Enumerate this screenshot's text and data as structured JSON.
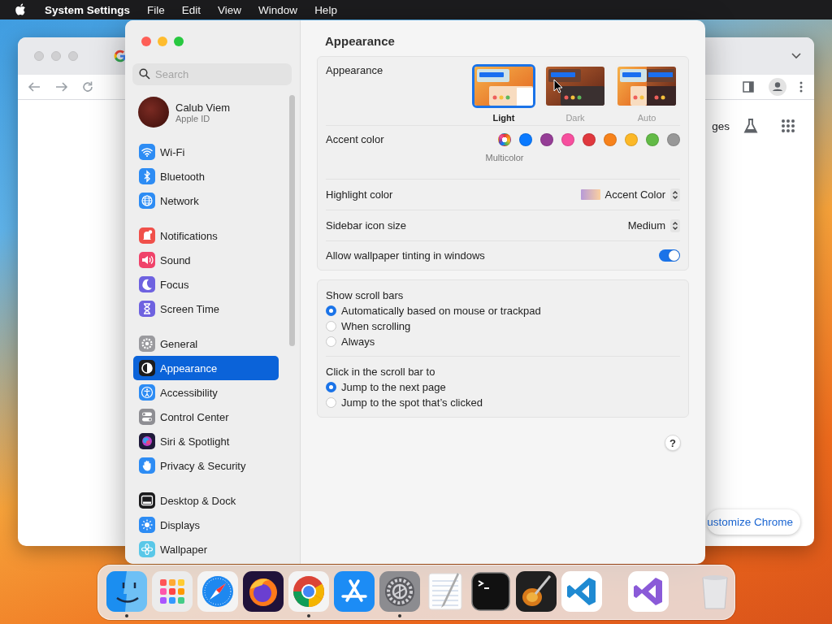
{
  "menu_bar": {
    "app_name": "System Settings",
    "menus": [
      "File",
      "Edit",
      "View",
      "Window",
      "Help"
    ]
  },
  "browser_window": {
    "link_text": "ges",
    "customize_button": "ustomize Chrome"
  },
  "settings_window": {
    "search": {
      "placeholder": "Search"
    },
    "account": {
      "name": "Calub Viem",
      "subtitle": "Apple ID"
    },
    "sidebar": {
      "groups": [
        {
          "items": [
            {
              "label": "Wi-Fi",
              "selected": false
            },
            {
              "label": "Bluetooth",
              "selected": false
            },
            {
              "label": "Network",
              "selected": false
            }
          ]
        },
        {
          "items": [
            {
              "label": "Notifications",
              "selected": false
            },
            {
              "label": "Sound",
              "selected": false
            },
            {
              "label": "Focus",
              "selected": false
            },
            {
              "label": "Screen Time",
              "selected": false
            }
          ]
        },
        {
          "items": [
            {
              "label": "General",
              "selected": false
            },
            {
              "label": "Appearance",
              "selected": true
            },
            {
              "label": "Accessibility",
              "selected": false
            },
            {
              "label": "Control Center",
              "selected": false
            },
            {
              "label": "Siri & Spotlight",
              "selected": false
            },
            {
              "label": "Privacy & Security",
              "selected": false
            }
          ]
        },
        {
          "items": [
            {
              "label": "Desktop & Dock",
              "selected": false
            },
            {
              "label": "Displays",
              "selected": false
            },
            {
              "label": "Wallpaper",
              "selected": false
            }
          ]
        }
      ]
    },
    "title": "Appearance",
    "appearance": {
      "label": "Appearance",
      "options": [
        {
          "kind": "light",
          "label": "Light",
          "selected": true
        },
        {
          "kind": "dark",
          "label": "Dark",
          "selected": false
        },
        {
          "kind": "auto",
          "label": "Auto",
          "selected": false
        }
      ]
    },
    "accent_color": {
      "label": "Accent color",
      "caption": "Multicolor",
      "colors": [
        {
          "kind": "multicolor",
          "selected": true
        },
        {
          "kind": "solid",
          "color": "#0a7aff",
          "selected": false
        },
        {
          "kind": "solid",
          "color": "#953d96",
          "selected": false
        },
        {
          "kind": "solid",
          "color": "#f74f9e",
          "selected": false
        },
        {
          "kind": "solid",
          "color": "#e0383e",
          "selected": false
        },
        {
          "kind": "solid",
          "color": "#f7821b",
          "selected": false
        },
        {
          "kind": "solid",
          "color": "#fcb827",
          "selected": false
        },
        {
          "kind": "solid",
          "color": "#62ba46",
          "selected": false
        },
        {
          "kind": "solid",
          "color": "#989898",
          "selected": false
        }
      ]
    },
    "highlight_color": {
      "label": "Highlight color",
      "value": "Accent Color"
    },
    "sidebar_icon_size": {
      "label": "Sidebar icon size",
      "value": "Medium"
    },
    "wallpaper_tinting": {
      "label": "Allow wallpaper tinting in windows",
      "on": true
    },
    "scroll_bars": {
      "label": "Show scroll bars",
      "options": [
        {
          "label": "Automatically based on mouse or trackpad",
          "selected": true
        },
        {
          "label": "When scrolling",
          "selected": false
        },
        {
          "label": "Always",
          "selected": false
        }
      ]
    },
    "scroll_click": {
      "label": "Click in the scroll bar to",
      "options": [
        {
          "label": "Jump to the next page",
          "selected": true
        },
        {
          "label": "Jump to the spot that’s clicked",
          "selected": false
        }
      ]
    },
    "help_button": "?"
  },
  "dock": {
    "items": [
      {
        "kind": "app",
        "running": true
      },
      {
        "kind": "app",
        "running": false
      },
      {
        "kind": "app",
        "running": false
      },
      {
        "kind": "app",
        "running": false
      },
      {
        "kind": "app",
        "running": true
      },
      {
        "kind": "app",
        "running": false
      },
      {
        "kind": "app",
        "running": true
      },
      {
        "kind": "app",
        "running": false
      },
      {
        "kind": "app",
        "running": false
      },
      {
        "kind": "app",
        "running": false
      },
      {
        "kind": "app",
        "running": false
      },
      {
        "kind": "separator"
      },
      {
        "kind": "app",
        "running": false
      },
      {
        "kind": "separator"
      },
      {
        "kind": "app",
        "running": false
      }
    ]
  }
}
